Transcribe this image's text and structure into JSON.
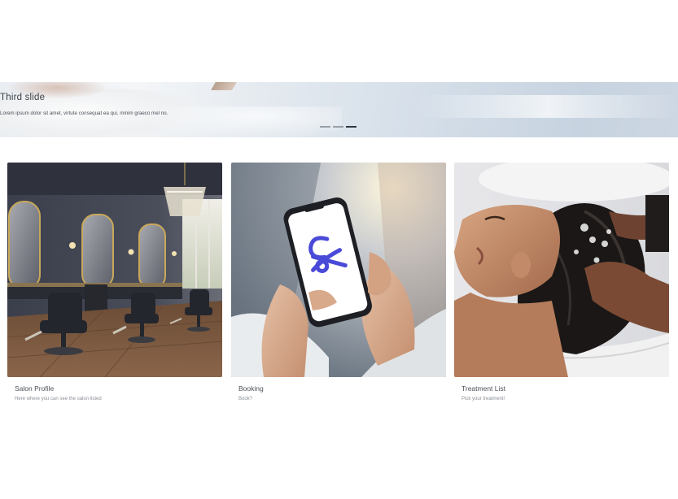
{
  "carousel": {
    "title": "Third slide",
    "text": "Lorem ipsum dolor sit amet, virtute consequat ea qui, minim graeco mel no.",
    "indicator_count": 3,
    "active_index": 2
  },
  "cards": [
    {
      "title": "Salon Profile",
      "text": "Here where you can see the salon listed"
    },
    {
      "title": "Booking",
      "text": "Book?"
    },
    {
      "title": "Treatment List",
      "text": "Pick your treatment!"
    }
  ],
  "colors": {
    "accent_logo": "#4a4ad8",
    "title_text": "#4b4f55",
    "muted_text": "#8a8f95"
  }
}
